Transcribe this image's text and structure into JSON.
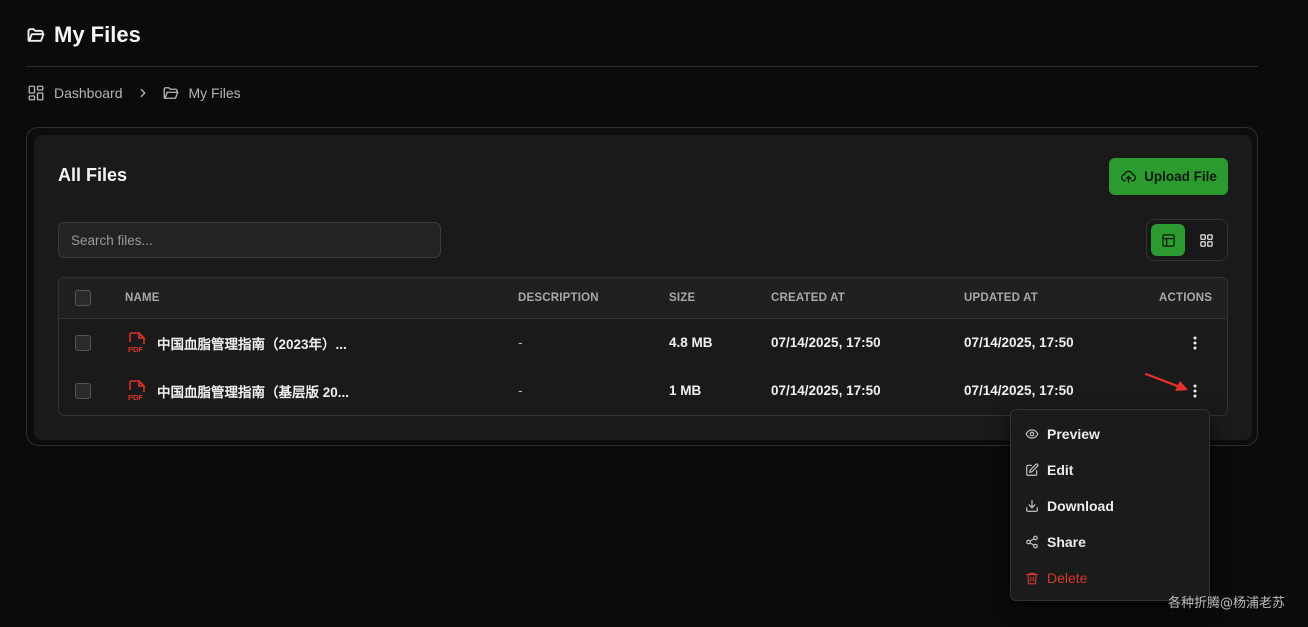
{
  "header": {
    "title": "My Files",
    "icon": "folder-open-icon"
  },
  "breadcrumb": {
    "items": [
      {
        "label": "Dashboard",
        "icon": "dashboard-icon"
      },
      {
        "label": "My Files",
        "icon": "folder-open-icon"
      }
    ]
  },
  "card": {
    "title": "All Files",
    "upload_label": "Upload File",
    "search_placeholder": "Search files...",
    "view_mode": "table"
  },
  "table": {
    "columns": {
      "name": "NAME",
      "description": "DESCRIPTION",
      "size": "SIZE",
      "created": "CREATED AT",
      "updated": "UPDATED AT",
      "actions": "ACTIONS"
    },
    "rows": [
      {
        "name": "中国血脂管理指南（2023年）...",
        "description": "-",
        "size": "4.8 MB",
        "created": "07/14/2025, 17:50",
        "updated": "07/14/2025, 17:50"
      },
      {
        "name": "中国血脂管理指南（基层版 20...",
        "description": "-",
        "size": "1 MB",
        "created": "07/14/2025, 17:50",
        "updated": "07/14/2025, 17:50"
      }
    ]
  },
  "menu": {
    "items": [
      {
        "label": "Preview",
        "icon": "eye-icon"
      },
      {
        "label": "Edit",
        "icon": "edit-icon"
      },
      {
        "label": "Download",
        "icon": "download-icon"
      },
      {
        "label": "Share",
        "icon": "share-icon"
      },
      {
        "label": "Delete",
        "icon": "trash-icon"
      }
    ]
  },
  "colors": {
    "accent": "#2b9b2f",
    "danger": "#d23a2c",
    "pointer": "#e8312a",
    "pdf": "#e0302a"
  },
  "watermark": "各种折腾@杨浦老苏"
}
